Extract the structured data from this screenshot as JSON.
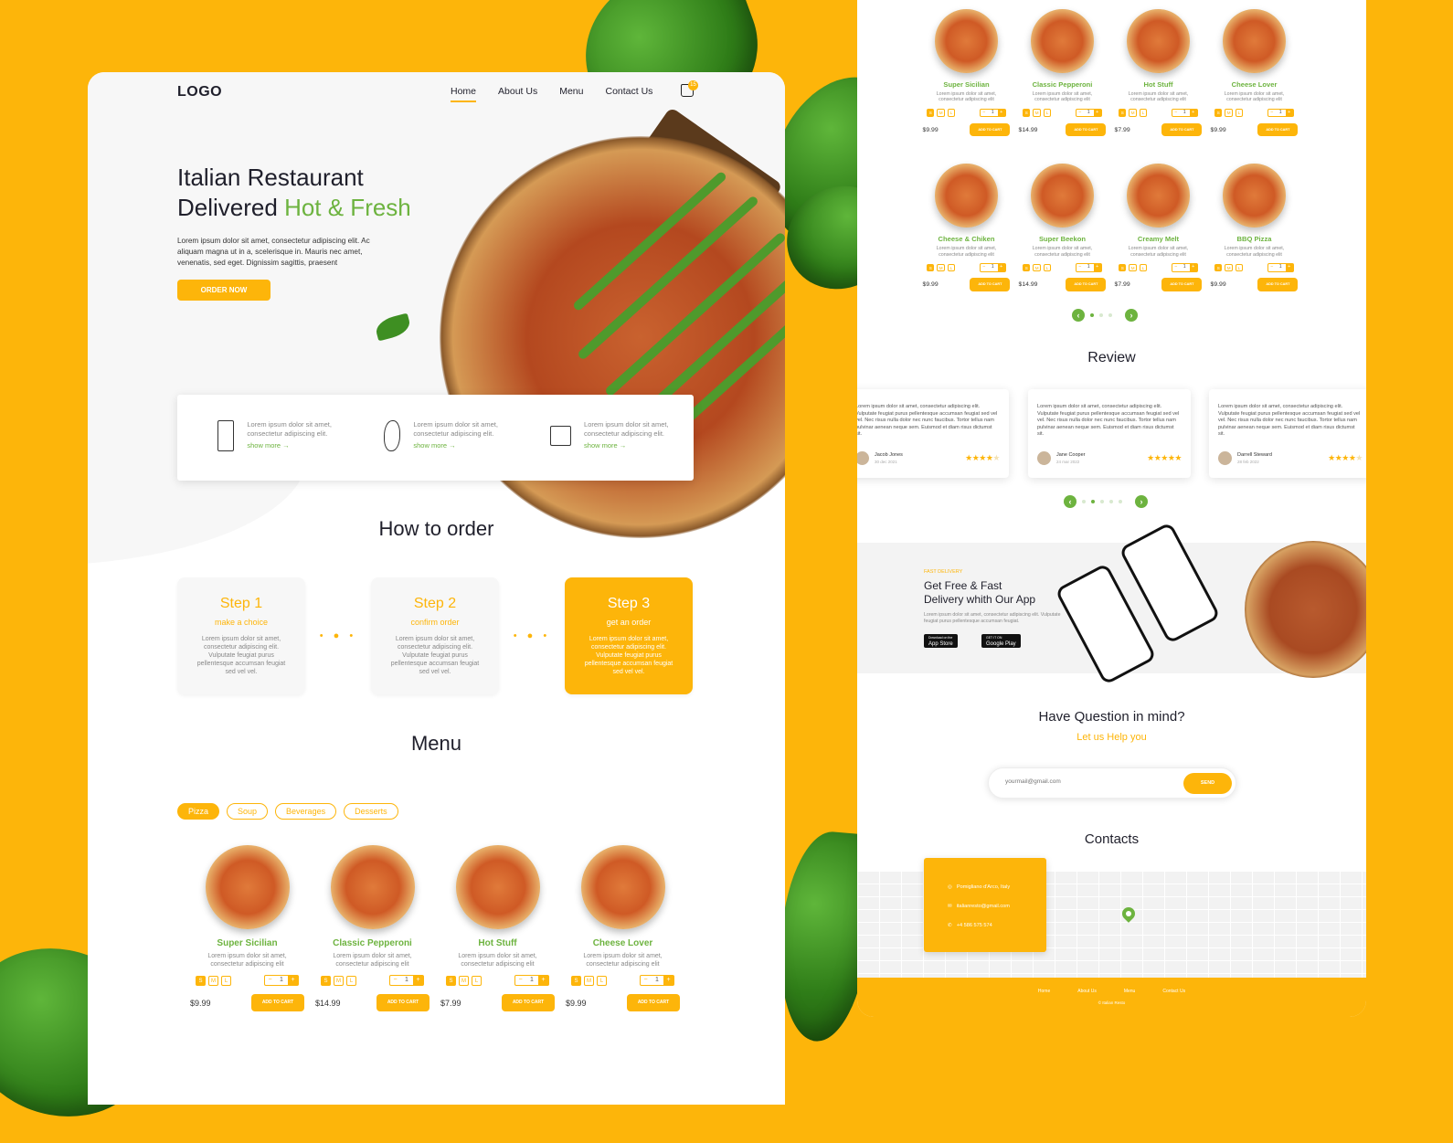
{
  "brand": {
    "logo": "LOGO",
    "accent": "#fdb50a",
    "green": "#6db33f"
  },
  "nav": {
    "items": [
      "Home",
      "About Us",
      "Menu",
      "Contact Us"
    ],
    "active": "Home",
    "cart_count": "15"
  },
  "hero": {
    "title_line1": "Italian Restaurant",
    "title_line2_plain": "Delivered ",
    "title_line2_accent": "Hot & Fresh",
    "lead": "Lorem ipsum dolor sit amet, consectetur adipiscing elit. Ac aliquam magna ut in a, scelerisque in. Mauris nec amet, venenatis, sed eget. Dignissim sagittis, praesent",
    "cta": "ORDER NOW"
  },
  "features": [
    {
      "icon": "menu-book-icon",
      "text": "Lorem ipsum dolor sit amet, consectetur adipiscing elit.",
      "link": "show more →"
    },
    {
      "icon": "lettuce-icon",
      "text": "Lorem ipsum dolor sit amet, consectetur adipiscing elit.",
      "link": "show more →"
    },
    {
      "icon": "delivery-truck-icon",
      "text": "Lorem ipsum dolor sit amet, consectetur adipiscing elit.",
      "link": "show more →"
    }
  ],
  "how_to_order": {
    "title": "How to order",
    "steps": [
      {
        "title": "Step 1",
        "subtitle": "make a choice",
        "text": "Lorem ipsum dolor sit amet, consectetur adipiscing elit. Vulputate feugiat purus pellentesque accumsan feugiat sed vel vel."
      },
      {
        "title": "Step 2",
        "subtitle": "confirm order",
        "text": "Lorem ipsum dolor sit amet, consectetur adipiscing elit. Vulputate feugiat purus pellentesque accumsan feugiat sed vel vel."
      },
      {
        "title": "Step 3",
        "subtitle": "get an order",
        "text": "Lorem ipsum dolor sit amet, consectetur adipiscing elit. Vulputate feugiat purus pellentesque accumsan feugiat sed vel vel."
      }
    ],
    "separator": "• ● •"
  },
  "menu": {
    "title": "Menu",
    "tabs": [
      "Pizza",
      "Soup",
      "Beverages",
      "Desserts"
    ],
    "active_tab": "Pizza",
    "sizes": [
      "S",
      "M",
      "L"
    ],
    "selected_size": "S",
    "qty_minus": "−",
    "qty_plus": "+",
    "add_to_cart": "ADD TO CART",
    "items": [
      {
        "name": "Super Sicilian",
        "desc": "Lorem ipsum dolor sit amet, consectetur adipiscing elit",
        "price": "$9.99",
        "qty": "1"
      },
      {
        "name": "Classic Pepperoni",
        "desc": "Lorem ipsum dolor sit amet, consectetur adipiscing elit",
        "price": "$14.99",
        "qty": "1"
      },
      {
        "name": "Hot Stuff",
        "desc": "Lorem ipsum dolor sit amet, consectetur adipiscing elit",
        "price": "$7.99",
        "qty": "1"
      },
      {
        "name": "Cheese Lover",
        "desc": "Lorem ipsum dolor sit amet, consectetur adipiscing elit",
        "price": "$9.99",
        "qty": "1"
      },
      {
        "name": "Cheese & Chiken",
        "desc": "Lorem ipsum dolor sit amet, consectetur adipiscing elit",
        "price": "$9.99",
        "qty": "1"
      },
      {
        "name": "Super Beekon",
        "desc": "Lorem ipsum dolor sit amet, consectetur adipiscing elit",
        "price": "$14.99",
        "qty": "1"
      },
      {
        "name": "Creamy Melt",
        "desc": "Lorem ipsum dolor sit amet, consectetur adipiscing elit",
        "price": "$7.99",
        "qty": "1"
      },
      {
        "name": "BBQ Pizza",
        "desc": "Lorem ipsum dolor sit amet, consectetur adipiscing elit",
        "price": "$9.99",
        "qty": "1"
      }
    ],
    "pager": {
      "prev": "‹",
      "next": "›",
      "pages": 3,
      "current": 1
    }
  },
  "reviews": {
    "title": "Review",
    "items": [
      {
        "text": "Lorem ipsum dolor sit amet, consectetur adipiscing elit. Vulputate feugiat purus pellentesque accumsan feugiat sed vel vel. Nec risus nulla dolor nec nunc faucibus. Tortor tellus nam pulvinar aenean neque sem. Euismod et diam risus dictumst sit.",
        "name": "Jacob Jones",
        "date": "30 dec 2021",
        "rating": 4
      },
      {
        "text": "Lorem ipsum dolor sit amet, consectetur adipiscing elit. Vulputate feugiat purus pellentesque accumsan feugiat sed vel vel. Nec risus nulla dolor nec nunc faucibus. Tortor tellus nam pulvinar aenean neque sem. Euismod et diam risus dictumst sit.",
        "name": "Jane Cooper",
        "date": "24 mar 2022",
        "rating": 5
      },
      {
        "text": "Lorem ipsum dolor sit amet, consectetur adipiscing elit. Vulputate feugiat purus pellentesque accumsan feugiat sed vel vel. Nec risus nulla dolor nec nunc faucibus. Tortor tellus nam pulvinar aenean neque sem. Euismod et diam risus dictumst sit.",
        "name": "Darrell Steward",
        "date": "28 feb 2022",
        "rating": 4
      }
    ],
    "pager": {
      "prev": "‹",
      "next": "›",
      "pages": 5,
      "current": 2
    }
  },
  "app_promo": {
    "tag": "FAST DELIVERY",
    "title_line1": "Get Free & Fast",
    "title_line2": "Delivery whith Our App",
    "text": "Lorem ipsum dolor sit amet, consectetur adipiscing elit. Vulputate feugiat purus pellentesque accumsan feugiat.",
    "app_store_small": "Download on the",
    "app_store": "App Store",
    "google_play_small": "GET IT ON",
    "google_play": "Google Play"
  },
  "question": {
    "title": "Have Question in mind?",
    "subtitle": "Let us Help you",
    "email_placeholder": "yourmail@gmail.com",
    "send": "SEND"
  },
  "contacts": {
    "title": "Contacts",
    "address": "Pomigliano d'Arco, Italy",
    "email": "italianresto@gmail.com",
    "phone": "+4 586 575 574"
  },
  "footer": {
    "links": [
      "Home",
      "About Us",
      "Menu",
      "Contact Us"
    ],
    "copy": "© Italian Resto"
  }
}
